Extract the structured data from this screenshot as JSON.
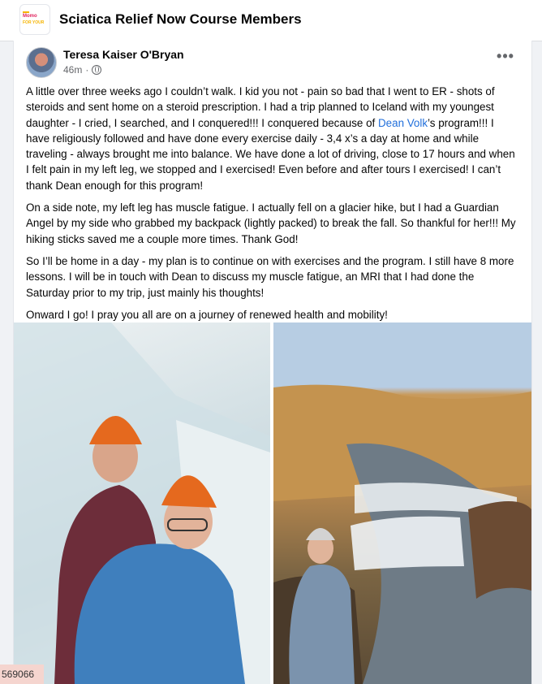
{
  "group": {
    "title": "Sciatica Relief Now Course Members",
    "logo_line1": "Momo",
    "logo_line2": "FOR YOUR"
  },
  "post": {
    "author": "Teresa Kaiser O'Bryan",
    "time": "46m",
    "more_label": "•••",
    "p1_a": "A little over three weeks ago I couldn’t walk.  I kid you not - pain so bad that I went to ER - shots of steroids and sent home on a steroid prescription.   I had a trip planned to Iceland with my youngest daughter - I cried, I searched, and I conquered!!!   I conquered because of ",
    "mention": "Dean Volk",
    "p1_b": "’s program!!!   I have religiously followed and have done every exercise daily - 3,4 x’s a day at home and while traveling - always brought me into balance.  We have done a lot of driving, close to 17 hours and when I felt pain in my left leg, we stopped and I exercised!  Even before and after tours I exercised!   I can’t thank Dean enough for this program!",
    "p2": "On a side note, my left leg has muscle fatigue.  I actually fell on a glacier hike, but I had a Guardian Angel by my side who grabbed my backpack (lightly packed) to break the fall. So thankful for her!!!  My hiking sticks saved me a couple more times.  Thank God!",
    "p3": "So I’ll be home in a day - my plan is to continue on with exercises and the program.  I still have 8 more lessons.  I will be in touch with Dean to discuss my muscle fatigue, an MRI that I had done the Saturday prior to my trip, just mainly his thoughts!",
    "p4": "Onward I go!  I pray you all are on a journey of renewed health and mobility!"
  },
  "footer": {
    "tag": "569066"
  },
  "colors": {
    "mention": "#216fdb",
    "background": "#f0f2f5"
  }
}
